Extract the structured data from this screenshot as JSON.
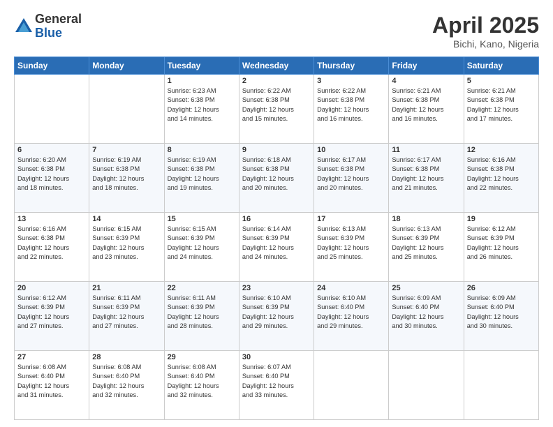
{
  "header": {
    "logo_general": "General",
    "logo_blue": "Blue",
    "month_title": "April 2025",
    "location": "Bichi, Kano, Nigeria"
  },
  "weekdays": [
    "Sunday",
    "Monday",
    "Tuesday",
    "Wednesday",
    "Thursday",
    "Friday",
    "Saturday"
  ],
  "weeks": [
    [
      {
        "day": "",
        "info": ""
      },
      {
        "day": "",
        "info": ""
      },
      {
        "day": "1",
        "info": "Sunrise: 6:23 AM\nSunset: 6:38 PM\nDaylight: 12 hours\nand 14 minutes."
      },
      {
        "day": "2",
        "info": "Sunrise: 6:22 AM\nSunset: 6:38 PM\nDaylight: 12 hours\nand 15 minutes."
      },
      {
        "day": "3",
        "info": "Sunrise: 6:22 AM\nSunset: 6:38 PM\nDaylight: 12 hours\nand 16 minutes."
      },
      {
        "day": "4",
        "info": "Sunrise: 6:21 AM\nSunset: 6:38 PM\nDaylight: 12 hours\nand 16 minutes."
      },
      {
        "day": "5",
        "info": "Sunrise: 6:21 AM\nSunset: 6:38 PM\nDaylight: 12 hours\nand 17 minutes."
      }
    ],
    [
      {
        "day": "6",
        "info": "Sunrise: 6:20 AM\nSunset: 6:38 PM\nDaylight: 12 hours\nand 18 minutes."
      },
      {
        "day": "7",
        "info": "Sunrise: 6:19 AM\nSunset: 6:38 PM\nDaylight: 12 hours\nand 18 minutes."
      },
      {
        "day": "8",
        "info": "Sunrise: 6:19 AM\nSunset: 6:38 PM\nDaylight: 12 hours\nand 19 minutes."
      },
      {
        "day": "9",
        "info": "Sunrise: 6:18 AM\nSunset: 6:38 PM\nDaylight: 12 hours\nand 20 minutes."
      },
      {
        "day": "10",
        "info": "Sunrise: 6:17 AM\nSunset: 6:38 PM\nDaylight: 12 hours\nand 20 minutes."
      },
      {
        "day": "11",
        "info": "Sunrise: 6:17 AM\nSunset: 6:38 PM\nDaylight: 12 hours\nand 21 minutes."
      },
      {
        "day": "12",
        "info": "Sunrise: 6:16 AM\nSunset: 6:38 PM\nDaylight: 12 hours\nand 22 minutes."
      }
    ],
    [
      {
        "day": "13",
        "info": "Sunrise: 6:16 AM\nSunset: 6:38 PM\nDaylight: 12 hours\nand 22 minutes."
      },
      {
        "day": "14",
        "info": "Sunrise: 6:15 AM\nSunset: 6:39 PM\nDaylight: 12 hours\nand 23 minutes."
      },
      {
        "day": "15",
        "info": "Sunrise: 6:15 AM\nSunset: 6:39 PM\nDaylight: 12 hours\nand 24 minutes."
      },
      {
        "day": "16",
        "info": "Sunrise: 6:14 AM\nSunset: 6:39 PM\nDaylight: 12 hours\nand 24 minutes."
      },
      {
        "day": "17",
        "info": "Sunrise: 6:13 AM\nSunset: 6:39 PM\nDaylight: 12 hours\nand 25 minutes."
      },
      {
        "day": "18",
        "info": "Sunrise: 6:13 AM\nSunset: 6:39 PM\nDaylight: 12 hours\nand 25 minutes."
      },
      {
        "day": "19",
        "info": "Sunrise: 6:12 AM\nSunset: 6:39 PM\nDaylight: 12 hours\nand 26 minutes."
      }
    ],
    [
      {
        "day": "20",
        "info": "Sunrise: 6:12 AM\nSunset: 6:39 PM\nDaylight: 12 hours\nand 27 minutes."
      },
      {
        "day": "21",
        "info": "Sunrise: 6:11 AM\nSunset: 6:39 PM\nDaylight: 12 hours\nand 27 minutes."
      },
      {
        "day": "22",
        "info": "Sunrise: 6:11 AM\nSunset: 6:39 PM\nDaylight: 12 hours\nand 28 minutes."
      },
      {
        "day": "23",
        "info": "Sunrise: 6:10 AM\nSunset: 6:39 PM\nDaylight: 12 hours\nand 29 minutes."
      },
      {
        "day": "24",
        "info": "Sunrise: 6:10 AM\nSunset: 6:40 PM\nDaylight: 12 hours\nand 29 minutes."
      },
      {
        "day": "25",
        "info": "Sunrise: 6:09 AM\nSunset: 6:40 PM\nDaylight: 12 hours\nand 30 minutes."
      },
      {
        "day": "26",
        "info": "Sunrise: 6:09 AM\nSunset: 6:40 PM\nDaylight: 12 hours\nand 30 minutes."
      }
    ],
    [
      {
        "day": "27",
        "info": "Sunrise: 6:08 AM\nSunset: 6:40 PM\nDaylight: 12 hours\nand 31 minutes."
      },
      {
        "day": "28",
        "info": "Sunrise: 6:08 AM\nSunset: 6:40 PM\nDaylight: 12 hours\nand 32 minutes."
      },
      {
        "day": "29",
        "info": "Sunrise: 6:08 AM\nSunset: 6:40 PM\nDaylight: 12 hours\nand 32 minutes."
      },
      {
        "day": "30",
        "info": "Sunrise: 6:07 AM\nSunset: 6:40 PM\nDaylight: 12 hours\nand 33 minutes."
      },
      {
        "day": "",
        "info": ""
      },
      {
        "day": "",
        "info": ""
      },
      {
        "day": "",
        "info": ""
      }
    ]
  ]
}
